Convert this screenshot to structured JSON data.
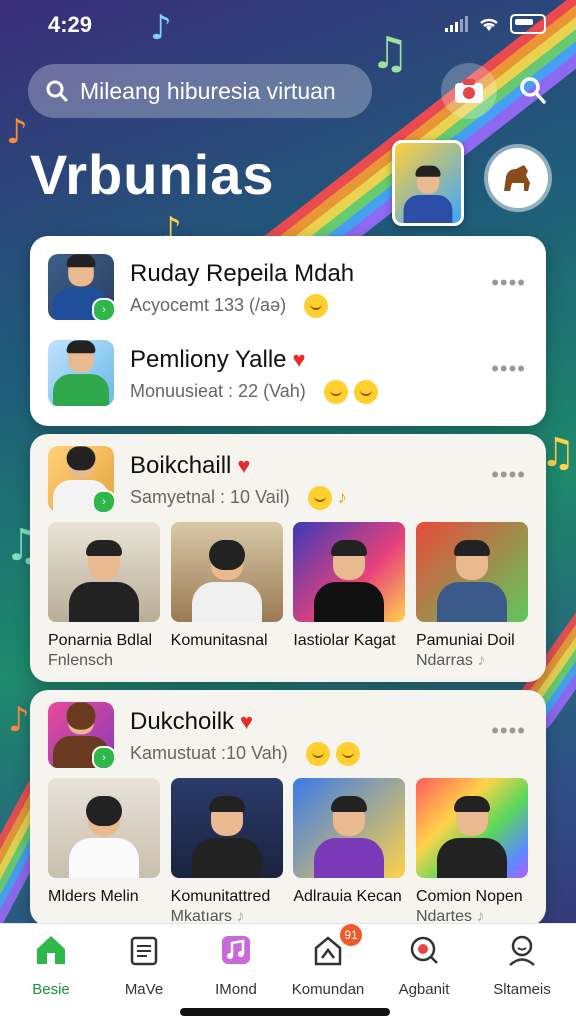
{
  "status": {
    "time": "4:29"
  },
  "search": {
    "placeholder": "Mileang hiburesia virtuan"
  },
  "app_title": "Vrbunias",
  "contacts": [
    {
      "name": "Ruday Repeila Mdah",
      "sub": "Acyocemt 133 (/aə)"
    },
    {
      "name": "Pemliony Yalle",
      "sub": "Monuusieat : 22 (Vah)"
    }
  ],
  "groups": [
    {
      "name": "Boikchaill",
      "sub": "Samyetnal : 10 Vail)",
      "tiles": [
        {
          "line1": "Ponarnia Bdlal",
          "line2": "Fnlensch"
        },
        {
          "line1": "Komunitasnal",
          "line2": ""
        },
        {
          "line1": "Iastiolar Kagat",
          "line2": ""
        },
        {
          "line1": "Pamuniai Doil",
          "line2": "Ndarras"
        }
      ]
    },
    {
      "name": "Dukchoilk",
      "sub": "Kamustuat :10 Vah)",
      "tiles": [
        {
          "line1": "Mlders Melin",
          "line2": ""
        },
        {
          "line1": "Komunitattred",
          "line2": "Mkatıars"
        },
        {
          "line1": "Adlrauia Kecan",
          "line2": ""
        },
        {
          "line1": "Comion Nopen",
          "line2": "Ndartes"
        }
      ]
    }
  ],
  "nav": [
    {
      "label": "Besie",
      "icon": "home-icon"
    },
    {
      "label": "MaVe",
      "icon": "calendar-icon"
    },
    {
      "label": "IMond",
      "icon": "music-icon"
    },
    {
      "label": "Komundan",
      "icon": "share-icon",
      "badge": "91"
    },
    {
      "label": "Agbanit",
      "icon": "target-icon"
    },
    {
      "label": "Sltameis",
      "icon": "profile-icon"
    }
  ],
  "colors": {
    "accent": "#1b8f3a",
    "heart": "#e52b2b",
    "badge": "#f05a2a"
  }
}
